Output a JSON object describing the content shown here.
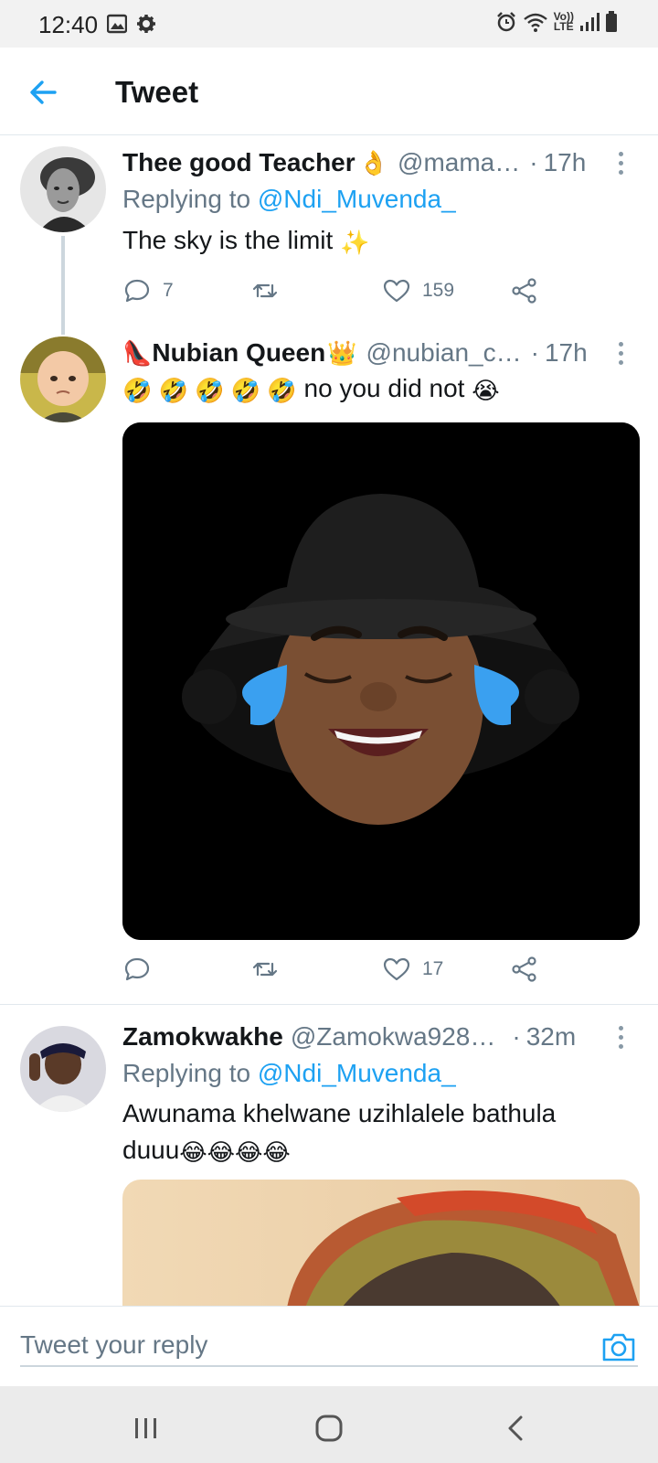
{
  "status_bar": {
    "time": "12:40",
    "left_icons": [
      "gallery-icon",
      "gear-icon"
    ],
    "right_icons": [
      "alarm-icon",
      "wifi-icon",
      "signal-icon",
      "battery-icon"
    ],
    "network_top": "Vo))",
    "network_bottom": "LTE"
  },
  "header": {
    "back_icon": "arrow-left-icon",
    "title": "Tweet"
  },
  "tweets": [
    {
      "name": "Thee good Teacher",
      "name_suffix_emoji": "👌",
      "handle": "@mama…",
      "dot": "·",
      "time": "17h",
      "replying_prefix": "Replying to",
      "replying_to": "@Ndi_Muvenda_",
      "text": "The sky is the limit",
      "text_emoji": "✨",
      "replies": "7",
      "retweets": "",
      "likes": "159"
    },
    {
      "name_prefix_emoji": "👠",
      "name": "Nubian Queen",
      "name_suffix_emoji": "👑",
      "handle": "@nubian_c…",
      "dot": "·",
      "time": "17h",
      "text_emojis": "🤣 🤣 🤣 🤣 🤣",
      "text": "no you did not",
      "text_emoji": "😭",
      "replies": "",
      "retweets": "",
      "likes": "17"
    },
    {
      "name": "Zamokwakhe",
      "handle": "@Zamokwa928…",
      "dot": "·",
      "time": "32m",
      "replying_prefix": "Replying to",
      "replying_to": "@Ndi_Muvenda_",
      "text_line1": "Awunama khelwane uzihlalele bathula",
      "text_line2": "duuu",
      "text_emoji": "😂😂😂😂"
    }
  ],
  "reply_bar": {
    "placeholder": "Tweet your reply",
    "camera_icon": "camera-icon"
  },
  "nav_bar": {
    "icons": [
      "recent-apps-icon",
      "home-icon",
      "back-icon"
    ]
  },
  "colors": {
    "accent": "#1da1f2",
    "secondary_text": "#657786",
    "divider": "#e1e8ed"
  }
}
